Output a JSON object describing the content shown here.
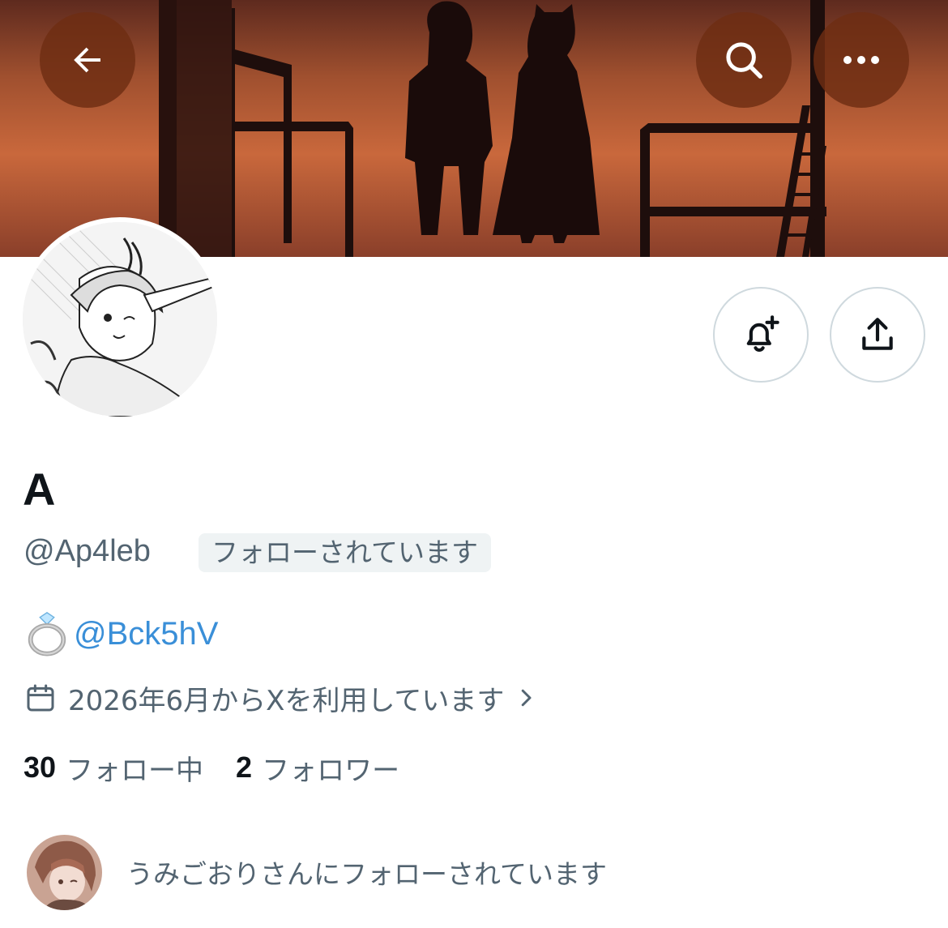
{
  "header": {
    "back_icon": "arrow-left-icon",
    "search_icon": "search-icon",
    "more_icon": "more-horizontal-icon"
  },
  "actions": {
    "notify_icon": "bell-plus-icon",
    "share_icon": "share-upload-icon"
  },
  "profile": {
    "display_name": "A",
    "handle": "@Ap4leb",
    "follows_you_badge": "フォローされています",
    "bio_link": "@Bck5hV",
    "joined": "2026年6月からXを利用しています",
    "following_count": "30",
    "following_label": "フォロー中",
    "followers_count": "2",
    "followers_label": "フォロワー",
    "followed_by_text": "うみごおりさんにフォローされています"
  },
  "colors": {
    "link": "#3a8fd8",
    "secondary_text": "#536471",
    "badge_bg": "#eff3f4"
  }
}
